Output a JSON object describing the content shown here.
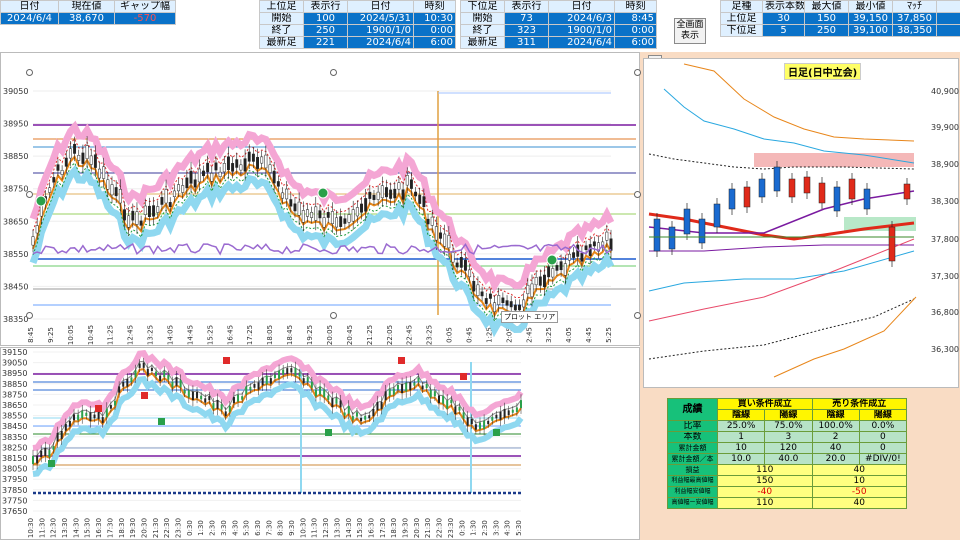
{
  "top_left": {
    "headers": [
      "日付",
      "現在値",
      "ギャップ幅"
    ],
    "values": [
      "2024/6/4",
      "38,670",
      "-570"
    ]
  },
  "upper_table": {
    "headers": [
      "上位足",
      "表示行",
      "日付",
      "時刻"
    ],
    "rows": [
      [
        "開始",
        "100",
        "2024/5/31",
        "10:30"
      ],
      [
        "終了",
        "250",
        "1900/1/0",
        "0:00"
      ],
      [
        "最新足",
        "221",
        "2024/6/4",
        "6:00"
      ]
    ]
  },
  "lower_table": {
    "headers": [
      "下位足",
      "表示行",
      "日付",
      "時刻"
    ],
    "rows": [
      [
        "開始",
        "73",
        "2024/6/3",
        "8:45"
      ],
      [
        "終了",
        "323",
        "1900/1/0",
        "0:00"
      ],
      [
        "最新足",
        "311",
        "2024/6/4",
        "6:00"
      ]
    ]
  },
  "full_screen_button": "全画面\n表示",
  "summary_table": {
    "headers": [
      "足種",
      "表示本数",
      "最大値",
      "最小値",
      "ﾏｯﾁ"
    ],
    "rows": [
      [
        "上位足",
        "30",
        "150",
        "39,150",
        "37,850"
      ],
      [
        "下位足",
        "5",
        "250",
        "39,100",
        "38,350"
      ]
    ]
  },
  "toolbar_icons": [
    "plus-icon",
    "pen-icon",
    "filter-icon"
  ],
  "daily_chart": {
    "title": "日足(日中立会)",
    "y_ticks": [
      "40,900",
      "39,900",
      "38,900",
      "38,300",
      "37,800",
      "37,300",
      "36,800",
      "36,300"
    ]
  },
  "main_chart": {
    "y_ticks": [
      "39050",
      "38950",
      "38850",
      "38750",
      "38650",
      "38550",
      "38450",
      "38350"
    ],
    "x_ticks": [
      "8:45",
      "9:25",
      "10:05",
      "10:45",
      "11:25",
      "12:45",
      "13:25",
      "14:05",
      "14:45",
      "15:25",
      "16:45",
      "17:25",
      "18:05",
      "18:45",
      "19:25",
      "20:05",
      "20:45",
      "21:25",
      "22:05",
      "22:45",
      "23:25",
      "0:05",
      "0:45",
      "1:25",
      "2:05",
      "2:45",
      "3:25",
      "4:05",
      "4:45",
      "5:25"
    ],
    "plot_area_label": "プロット エリア"
  },
  "lower_chart": {
    "y_ticks": [
      "39150",
      "39050",
      "38950",
      "38850",
      "38750",
      "38650",
      "38550",
      "38450",
      "38350",
      "38250",
      "38150",
      "38050",
      "37950",
      "37850",
      "37750",
      "37650"
    ],
    "x_ticks": [
      "10:30",
      "11:30",
      "12:30",
      "13:30",
      "14:30",
      "15:30",
      "16:30",
      "17:30",
      "18:30",
      "19:30",
      "20:30",
      "21:30",
      "22:30",
      "23:30",
      "0:30",
      "1:30",
      "2:30",
      "3:30",
      "4:30",
      "5:30",
      "6:30",
      "7:30",
      "8:30",
      "9:30",
      "10:30",
      "11:30",
      "12:30",
      "13:30",
      "14:30",
      "15:30",
      "16:30",
      "17:30",
      "18:30",
      "19:30",
      "20:30",
      "21:30",
      "22:30",
      "23:30",
      "0:30",
      "1:30",
      "2:30",
      "3:30",
      "4:30",
      "5:30"
    ]
  },
  "results_table": {
    "title": "成績",
    "buy_header": "買い条件成立",
    "sell_header": "売り条件成立",
    "sub_headers": [
      "陰線",
      "陽線",
      "陰線",
      "陽線"
    ],
    "rows": [
      {
        "label": "比率",
        "values": [
          "25.0%",
          "75.0%",
          "100.0%",
          "0.0%"
        ]
      },
      {
        "label": "本数",
        "values": [
          "1",
          "3",
          "2",
          "0"
        ]
      },
      {
        "label": "累計金額",
        "values": [
          "10",
          "120",
          "40",
          "0"
        ]
      },
      {
        "label": "累計金額／本",
        "values": [
          "10.0",
          "40.0",
          "20.0",
          "#DIV/0!"
        ]
      }
    ],
    "merged_rows": [
      {
        "label": "損益",
        "buy": "110",
        "sell": "40"
      },
      {
        "label": "利益幅最高値幅",
        "buy": "150",
        "sell": "10"
      },
      {
        "label": "利益幅安値幅",
        "buy": "-40",
        "sell": "-50"
      },
      {
        "label": "高値幅ー安値幅",
        "buy": "110",
        "sell": "40"
      }
    ]
  },
  "colors": {
    "header_blue": "#0a72c8",
    "negative": "#ff5050",
    "results_green": "#17c17a",
    "results_yellow": "#fff600",
    "panel_peach": "#f9dcc4"
  }
}
